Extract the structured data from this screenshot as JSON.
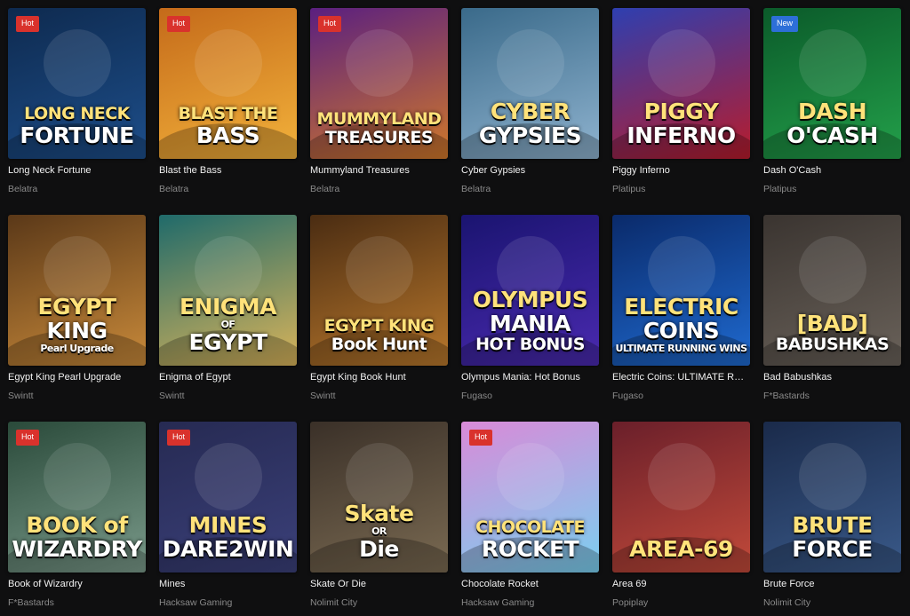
{
  "games": [
    {
      "name": "Long Neck Fortune",
      "provider": "Belatra",
      "badge": "Hot",
      "art": [
        "LONG NECK",
        "FORTUNE"
      ],
      "colors": [
        "#0e2a4f",
        "#1d4e8a"
      ]
    },
    {
      "name": "Blast the Bass",
      "provider": "Belatra",
      "badge": "Hot",
      "art": [
        "BLAST THE",
        "BASS"
      ],
      "colors": [
        "#c46a1a",
        "#f3b23b"
      ]
    },
    {
      "name": "Mummyland Treasures",
      "provider": "Belatra",
      "badge": "Hot",
      "art": [
        "MUMMYLAND",
        "TREASURES"
      ],
      "colors": [
        "#5a1f80",
        "#d0782a"
      ]
    },
    {
      "name": "Cyber Gypsies",
      "provider": "Belatra",
      "badge": "",
      "art": [
        "CYBER",
        "GYPSIES"
      ],
      "colors": [
        "#3a6a8a",
        "#8fb3cf"
      ]
    },
    {
      "name": "Piggy Inferno",
      "provider": "Platipus",
      "badge": "",
      "art": [
        "PIGGY",
        "INFERNO"
      ],
      "colors": [
        "#2e3fb0",
        "#b81c2c"
      ]
    },
    {
      "name": "Dash O'Cash",
      "provider": "Platipus",
      "badge": "New",
      "art": [
        "DASH",
        "O'CASH"
      ],
      "colors": [
        "#0b5a2a",
        "#23a04a"
      ]
    },
    {
      "name": "Egypt King Pearl Upgrade",
      "provider": "Swintt",
      "badge": "",
      "art": [
        "EGYPT",
        "KING",
        "Pearl Upgrade"
      ],
      "colors": [
        "#5a3818",
        "#c98a3a"
      ]
    },
    {
      "name": "Enigma of Egypt",
      "provider": "Swintt",
      "badge": "",
      "art": [
        "ENIGMA",
        "OF",
        "EGYPT"
      ],
      "colors": [
        "#1f6a6a",
        "#d9b45a"
      ]
    },
    {
      "name": "Egypt King Book Hunt",
      "provider": "Swintt",
      "badge": "",
      "art": [
        "EGYPT KING",
        "Book Hunt"
      ],
      "colors": [
        "#4a2c12",
        "#b9782c"
      ]
    },
    {
      "name": "Olympus Mania: Hot Bonus",
      "provider": "Fugaso",
      "badge": "",
      "art": [
        "OLYMPUS",
        "MANIA",
        "HOT BONUS"
      ],
      "colors": [
        "#1a1470",
        "#4a2ab0"
      ]
    },
    {
      "name": "Electric Coins: ULTIMATE RUNNING WINS",
      "provider": "Fugaso",
      "badge": "",
      "art": [
        "ELECTRIC",
        "COINS",
        "ULTIMATE RUNNING WINS"
      ],
      "colors": [
        "#0a2a6a",
        "#1f6ad0"
      ]
    },
    {
      "name": "Bad Babushkas",
      "provider": "F*Bastards",
      "badge": "",
      "art": [
        "[BAD]",
        "BABUSHKAS"
      ],
      "colors": [
        "#3a3430",
        "#6a625a"
      ]
    },
    {
      "name": "Book of Wizardry",
      "provider": "F*Bastards",
      "badge": "Hot",
      "art": [
        "BOOK of",
        "WIZARDRY"
      ],
      "colors": [
        "#2a4a3a",
        "#7a9a8a"
      ]
    },
    {
      "name": "Mines",
      "provider": "Hacksaw Gaming",
      "badge": "Hot",
      "art": [
        "MINES",
        "DARE2WIN"
      ],
      "colors": [
        "#262a52",
        "#3b407a"
      ]
    },
    {
      "name": "Skate Or Die",
      "provider": "Nolimit City",
      "badge": "",
      "art": [
        "Skate",
        "OR",
        "Die"
      ],
      "colors": [
        "#3a3028",
        "#7a6a52"
      ]
    },
    {
      "name": "Chocolate Rocket",
      "provider": "Hacksaw Gaming",
      "badge": "Hot",
      "art": [
        "CHOCOLATE",
        "ROCKET"
      ],
      "colors": [
        "#d98ad8",
        "#7ad0f0"
      ]
    },
    {
      "name": "Area 69",
      "provider": "Popiplay",
      "badge": "",
      "art": [
        "AREA-69"
      ],
      "colors": [
        "#6a1f2a",
        "#c24a3a"
      ]
    },
    {
      "name": "Brute Force",
      "provider": "Nolimit City",
      "badge": "",
      "art": [
        "BRUTE",
        "FORCE"
      ],
      "colors": [
        "#1a2a4a",
        "#3a5a8a"
      ]
    }
  ]
}
